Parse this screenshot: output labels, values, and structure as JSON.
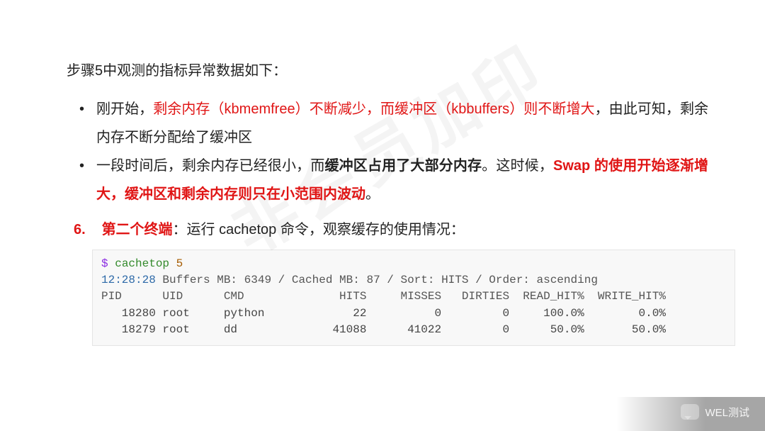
{
  "watermark": "非会员加印",
  "intro": "步骤5中观测的指标异常数据如下：",
  "bullets": [
    {
      "parts": [
        {
          "t": "刚开始，",
          "c": "plain"
        },
        {
          "t": "剩余内存（kbmemfree）不断减少，而缓冲区（kbbuffers）则不断增大",
          "c": "red"
        },
        {
          "t": "，由此可知，剩余内存不断分配给了缓冲区",
          "c": "plain"
        }
      ]
    },
    {
      "parts": [
        {
          "t": "一段时间后，剩余内存已经很小，而",
          "c": "plain"
        },
        {
          "t": "缓冲区占用了大部分内存",
          "c": "bold"
        },
        {
          "t": "。这时候，",
          "c": "plain"
        },
        {
          "t": "Swap 的使用开始逐渐增大，缓冲区和剩余内存则只在小范围内波动",
          "c": "redb"
        },
        {
          "t": "。",
          "c": "plain"
        }
      ]
    }
  ],
  "step6": {
    "num": "6.",
    "term": "第二个终端",
    "rest": "：运行 cachetop 命令，观察缓存的使用情况："
  },
  "code": {
    "prompt": "$",
    "cmd": "cachetop",
    "arg": "5",
    "time": "12:28:28",
    "statline": " Buffers MB: 6349 / Cached MB: 87 / Sort: HITS / Order: ascending",
    "header": "PID      UID      CMD              HITS     MISSES   DIRTIES  READ_HIT%  WRITE_HIT%",
    "rows": [
      "   18280 root     python             22          0         0     100.0%        0.0%",
      "   18279 root     dd              41088      41022         0      50.0%       50.0%"
    ]
  },
  "footer": {
    "label": "WEL测试"
  },
  "chart_data": {
    "type": "table",
    "title": "cachetop 5",
    "timestamp": "12:28:28",
    "buffers_mb": 6349,
    "cached_mb": 87,
    "sort": "HITS",
    "order": "ascending",
    "columns": [
      "PID",
      "UID",
      "CMD",
      "HITS",
      "MISSES",
      "DIRTIES",
      "READ_HIT%",
      "WRITE_HIT%"
    ],
    "rows": [
      {
        "PID": 18280,
        "UID": "root",
        "CMD": "python",
        "HITS": 22,
        "MISSES": 0,
        "DIRTIES": 0,
        "READ_HIT%": 100.0,
        "WRITE_HIT%": 0.0
      },
      {
        "PID": 18279,
        "UID": "root",
        "CMD": "dd",
        "HITS": 41088,
        "MISSES": 41022,
        "DIRTIES": 0,
        "READ_HIT%": 50.0,
        "WRITE_HIT%": 50.0
      }
    ]
  }
}
